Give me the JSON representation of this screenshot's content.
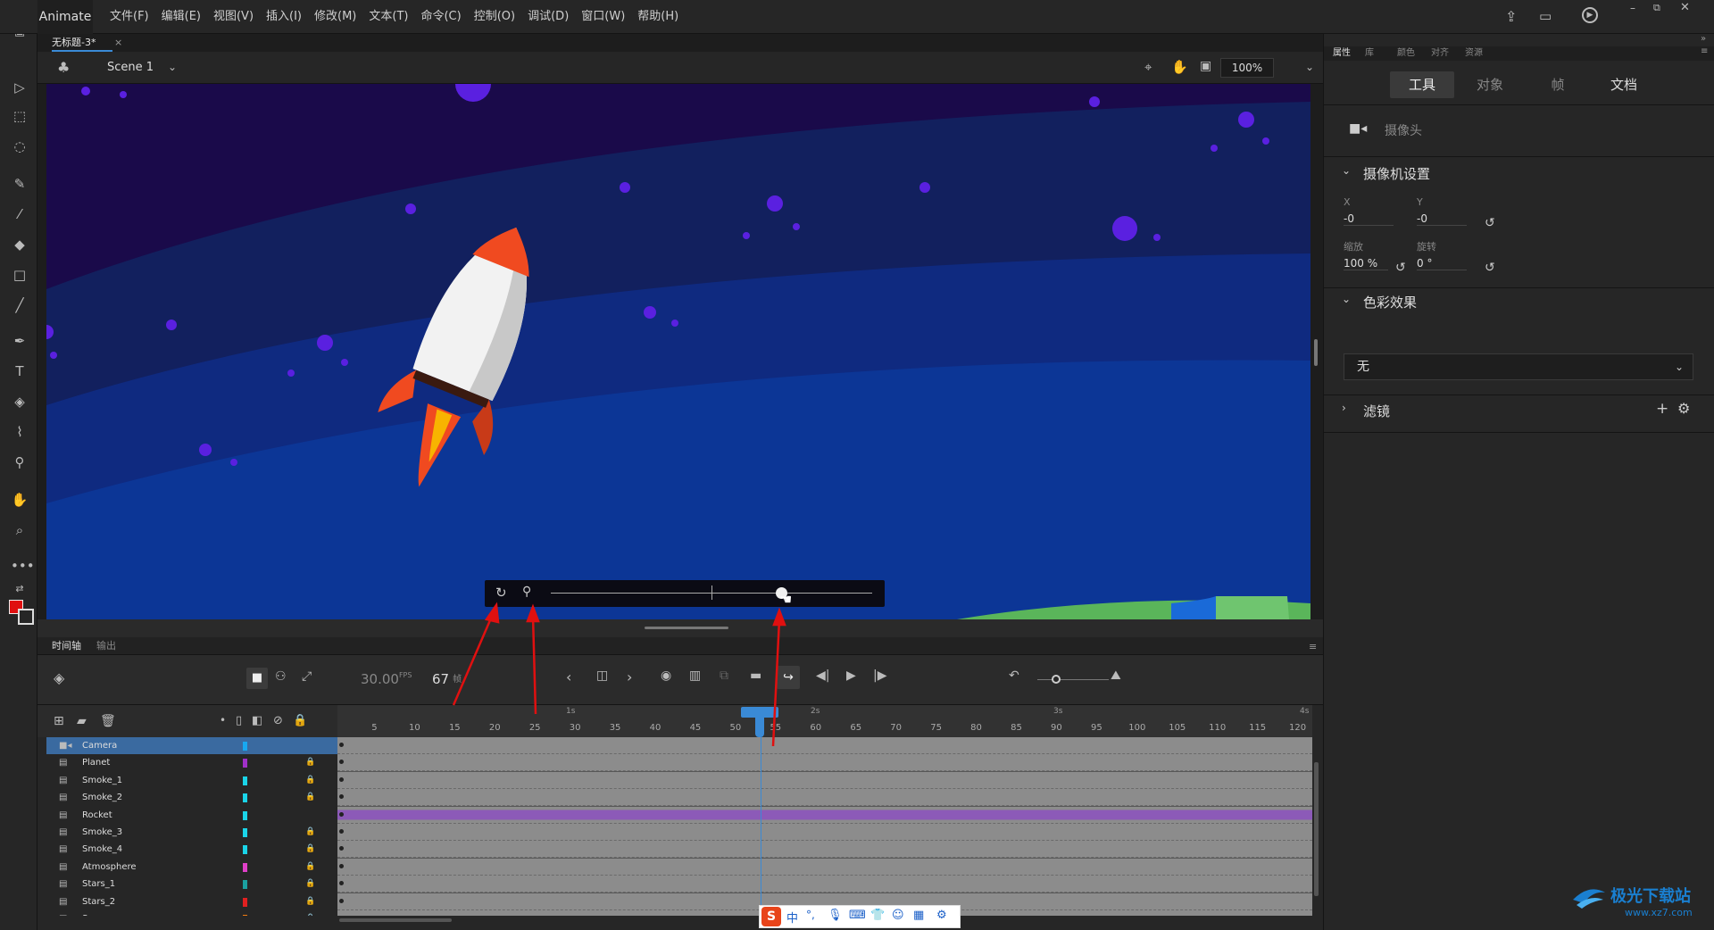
{
  "app": {
    "name": "Animate"
  },
  "menu": [
    "文件(F)",
    "编辑(E)",
    "视图(V)",
    "插入(I)",
    "修改(M)",
    "文本(T)",
    "命令(C)",
    "控制(O)",
    "调试(D)",
    "窗口(W)",
    "帮助(H)"
  ],
  "document": {
    "tab_title": "无标题-3*",
    "close": "×"
  },
  "stage_header": {
    "scene": "Scene 1",
    "zoom": "100%"
  },
  "timeline": {
    "tabs": [
      "时间轴",
      "输出"
    ],
    "fps_value": "30.00",
    "fps_unit": "FPS",
    "frame_value": "67",
    "frame_unit": "帧",
    "ruler_seconds": [
      "1s",
      "2s",
      "3s",
      "4s"
    ],
    "ruler_frames": [
      "5",
      "10",
      "15",
      "20",
      "25",
      "30",
      "35",
      "40",
      "45",
      "50",
      "55",
      "60",
      "65",
      "70",
      "75",
      "80",
      "85",
      "90",
      "95",
      "100",
      "105",
      "110",
      "115",
      "120"
    ],
    "layers": [
      {
        "name": "Camera",
        "color": "#18a8f0",
        "locked": false,
        "selected": true
      },
      {
        "name": "Planet",
        "color": "#a030c8",
        "locked": true
      },
      {
        "name": "Smoke_1",
        "color": "#1ad4e8",
        "locked": true
      },
      {
        "name": "Smoke_2",
        "color": "#1ad4e8",
        "locked": true
      },
      {
        "name": "Rocket",
        "color": "#1ad4e8",
        "locked": false
      },
      {
        "name": "Smoke_3",
        "color": "#1ad4e8",
        "locked": true
      },
      {
        "name": "Smoke_4",
        "color": "#1ad4e8",
        "locked": true
      },
      {
        "name": "Atmosphere",
        "color": "#e040c8",
        "locked": true
      },
      {
        "name": "Stars_1",
        "color": "#1aa0a0",
        "locked": true
      },
      {
        "name": "Stars_2",
        "color": "#e02020",
        "locked": true
      },
      {
        "name": "Space",
        "color": "#f07a10",
        "locked": true
      }
    ],
    "playhead_frame": 67
  },
  "properties": {
    "tabs": [
      "属性",
      "库",
      "颜色",
      "对齐",
      "资源"
    ],
    "subtabs": [
      "工具",
      "对象",
      "帧",
      "文档"
    ],
    "tool_name": "摄像头",
    "camera_section": "摄像机设置",
    "x_label": "X",
    "x_value": "-0",
    "y_label": "Y",
    "y_value": "-0",
    "scale_label": "缩放",
    "scale_value": "100 %",
    "rotate_label": "旋转",
    "rotate_value": "0 °",
    "color_section": "色彩效果",
    "color_effect": "无",
    "filter_section": "滤镜"
  },
  "ime": {
    "label": "中"
  },
  "watermark": {
    "text": "极光下载站",
    "url": "www.xz7.com"
  },
  "colors": {
    "accent": "#3a8ad6",
    "stage_bg": "#1a0a4a",
    "fill_color": "#e01010"
  }
}
